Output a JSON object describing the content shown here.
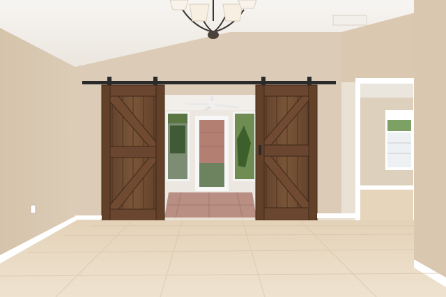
{
  "scene": {
    "type": "photograph",
    "subject": "interior-room",
    "palette": {
      "wall": "#dccbb6",
      "wall_shadow": "#cbb79f",
      "ceiling": "#f1eee9",
      "floor": "#eadbc4",
      "trim": "#ffffff",
      "barn_wood": "#6f4c33",
      "barn_wood_dark": "#4a3021",
      "rail": "#2a2a2a",
      "sunroom_tile": "#b98f83",
      "exterior_green": "#5f7b46"
    },
    "fixtures": {
      "chandelier": "chandelier",
      "ceiling_fan": "ceiling-fan",
      "barn_doors": 2,
      "wall_outlet": "outlet"
    }
  }
}
